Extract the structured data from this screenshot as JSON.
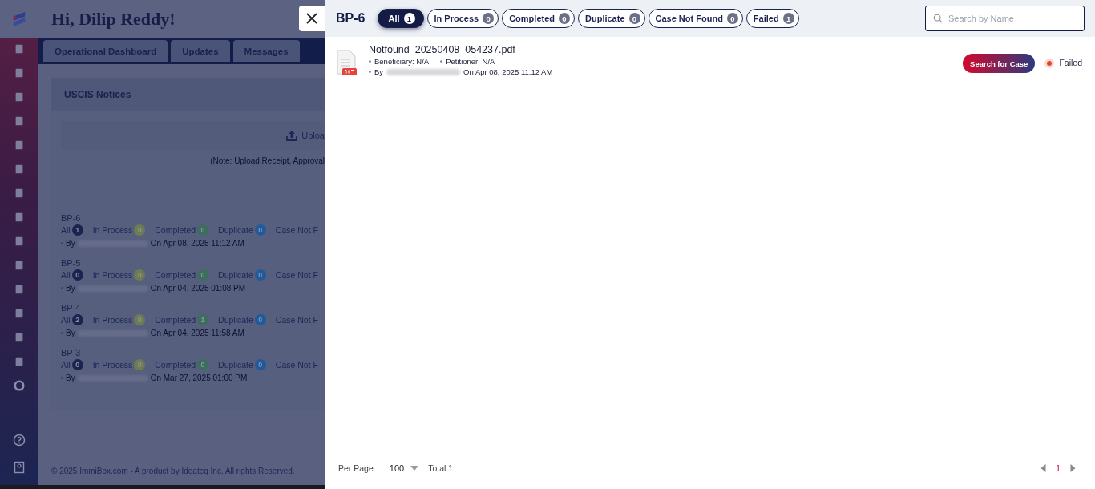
{
  "background": {
    "greeting": "Hi, Dilip Reddy!",
    "tabs": [
      "Operational Dashboard",
      "Updates",
      "Messages"
    ],
    "card_title": "USCIS Notices",
    "upload_label": "Uploa",
    "note": "(Note: Upload Receipt, Approval",
    "batches": [
      {
        "name": "BP-6",
        "counts": [
          {
            "label": "All",
            "value": "1",
            "kind": "all"
          },
          {
            "label": "In Process",
            "value": "0",
            "kind": "process"
          },
          {
            "label": "Completed",
            "value": "0",
            "kind": "completed"
          },
          {
            "label": "Duplicate",
            "value": "0",
            "kind": "duplicate"
          }
        ],
        "cut_label": "Case Not F",
        "by": "By",
        "date": "On Apr 08, 2025 11:12 AM"
      },
      {
        "name": "BP-5",
        "counts": [
          {
            "label": "All",
            "value": "0",
            "kind": "all"
          },
          {
            "label": "In Process",
            "value": "0",
            "kind": "process"
          },
          {
            "label": "Completed",
            "value": "0",
            "kind": "completed"
          },
          {
            "label": "Duplicate",
            "value": "0",
            "kind": "duplicate"
          }
        ],
        "cut_label": "Case Not F",
        "by": "By",
        "date": "On Apr 04, 2025 01:08 PM"
      },
      {
        "name": "BP-4",
        "counts": [
          {
            "label": "All",
            "value": "2",
            "kind": "all"
          },
          {
            "label": "In Process",
            "value": "0",
            "kind": "process"
          },
          {
            "label": "Completed",
            "value": "1",
            "kind": "completed"
          },
          {
            "label": "Duplicate",
            "value": "0",
            "kind": "duplicate"
          }
        ],
        "cut_label": "Case Not F",
        "by": "By",
        "date": "On Apr 04, 2025 11:58 AM"
      },
      {
        "name": "BP-3",
        "counts": [
          {
            "label": "All",
            "value": "0",
            "kind": "all"
          },
          {
            "label": "In Process",
            "value": "0",
            "kind": "process"
          },
          {
            "label": "Completed",
            "value": "0",
            "kind": "completed"
          },
          {
            "label": "Duplicate",
            "value": "0",
            "kind": "duplicate"
          }
        ],
        "cut_label": "Case Not F",
        "by": "By",
        "date": "On Mar 27, 2025 01:00 PM"
      }
    ],
    "footer": "© 2025 ImmiBox.com - A product by Ideateq Inc. All rights Reserved."
  },
  "drawer": {
    "title": "BP-6",
    "filters": [
      {
        "label": "All",
        "count": "1",
        "selected": true
      },
      {
        "label": "In Process",
        "count": "0",
        "selected": false
      },
      {
        "label": "Completed",
        "count": "0",
        "selected": false
      },
      {
        "label": "Duplicate",
        "count": "0",
        "selected": false
      },
      {
        "label": "Case Not Found",
        "count": "0",
        "selected": false
      },
      {
        "label": "Failed",
        "count": "1",
        "selected": false
      }
    ],
    "search": {
      "placeholder": "Search by Name"
    },
    "files": [
      {
        "name": "Notfound_20250408_054237.pdf",
        "beneficiary": "Beneficiary: N/A",
        "petitioner": "Petitioner: N/A",
        "by": "By",
        "date": "On Apr 08, 2025 11:12 AM",
        "action": "Search for Case",
        "status": "Failed",
        "color": "#e8412c"
      }
    ],
    "pagination": {
      "per_page_label": "Per Page",
      "per_page": "100",
      "total": "Total 1",
      "page": "1"
    }
  }
}
